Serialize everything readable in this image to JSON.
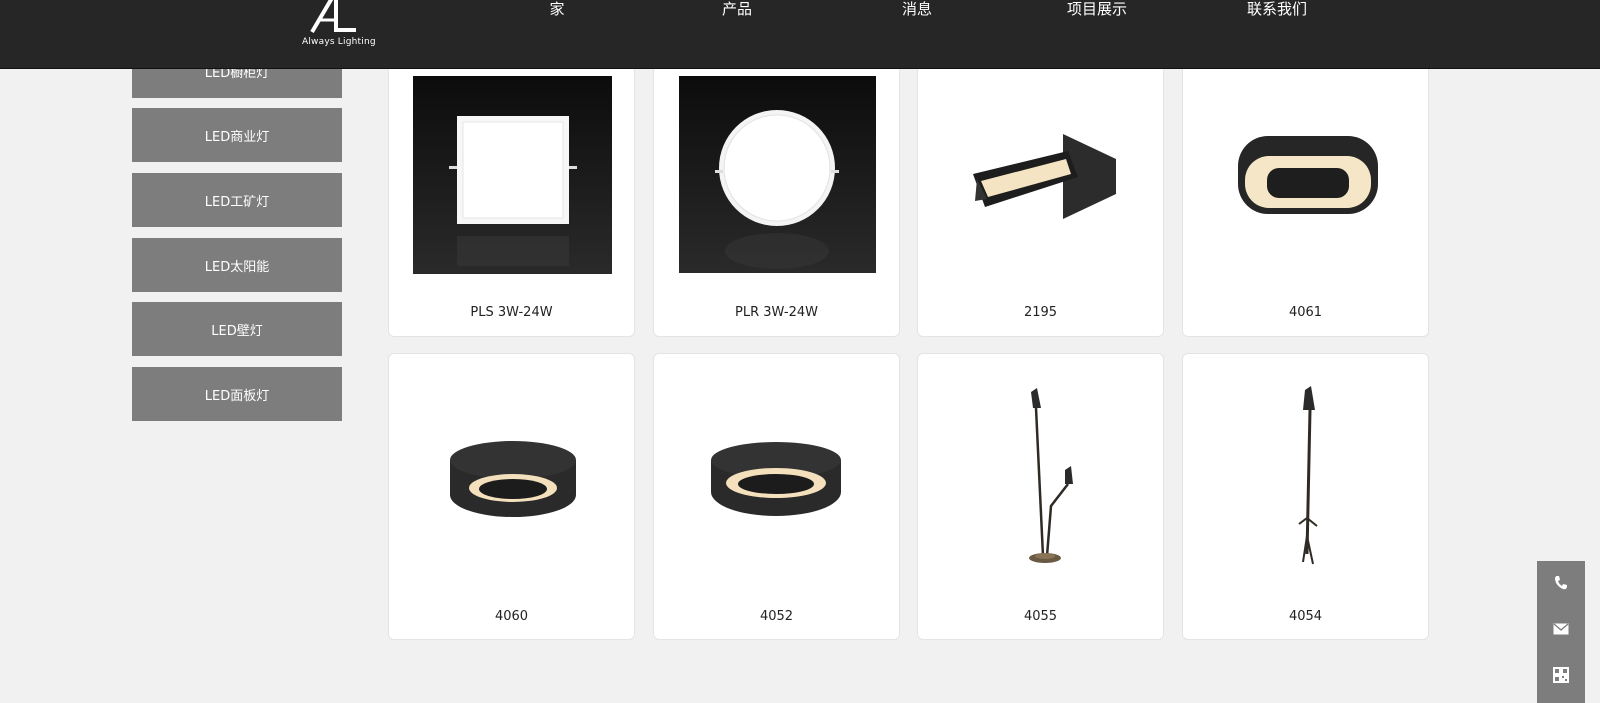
{
  "brand": {
    "tagline": "Always Lighting"
  },
  "nav": {
    "items": [
      {
        "label": "家"
      },
      {
        "label": "产品"
      },
      {
        "label": "消息"
      },
      {
        "label": "项目展示"
      },
      {
        "label": "联系我们"
      }
    ]
  },
  "sidebar": {
    "items": [
      {
        "label": "LED橱柜灯"
      },
      {
        "label": "LED商业灯"
      },
      {
        "label": "LED工矿灯"
      },
      {
        "label": "LED太阳能"
      },
      {
        "label": "LED壁灯"
      },
      {
        "label": "LED面板灯"
      }
    ]
  },
  "products": [
    {
      "name": "PLS 3W-24W"
    },
    {
      "name": "PLR 3W-24W"
    },
    {
      "name": "2195"
    },
    {
      "name": "4061"
    },
    {
      "name": "4060"
    },
    {
      "name": "4052"
    },
    {
      "name": "4055"
    },
    {
      "name": "4054"
    }
  ],
  "contact_bar": {
    "icons": [
      "phone-icon",
      "mail-icon",
      "qrcode-icon"
    ]
  },
  "colors": {
    "header_bg": "#262626",
    "sidebar_bg": "#7d7d7d",
    "page_bg": "#f1f1f1"
  }
}
